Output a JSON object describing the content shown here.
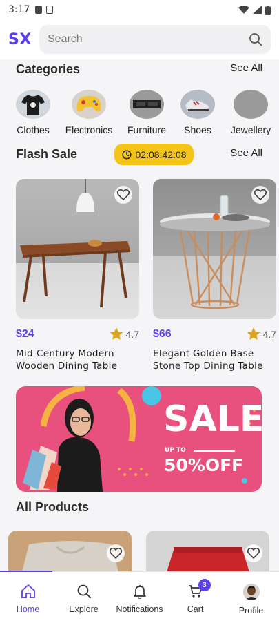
{
  "status_bar": {
    "time": "3:17"
  },
  "header": {
    "logo": "SX",
    "search_placeholder": "Search"
  },
  "categories": {
    "title": "Categories",
    "see_all": "See All",
    "items": [
      {
        "label": "Clothes",
        "icon": "tshirt-image"
      },
      {
        "label": "Electronics",
        "icon": "gamepad-image"
      },
      {
        "label": "Furniture",
        "icon": "tv-console-image"
      },
      {
        "label": "Shoes",
        "icon": "sneakers-image"
      },
      {
        "label": "Jewellery",
        "icon": "placeholder-image"
      }
    ]
  },
  "flash_sale": {
    "title": "Flash Sale",
    "timer": "02:08:42:08",
    "see_all": "See All",
    "products": [
      {
        "price": "$24",
        "rating": "4.7",
        "name_line1": "Mid-Century Modern",
        "name_line2": "Wooden Dining Table"
      },
      {
        "price": "$66",
        "rating": "4.7",
        "name_line1": "Elegant Golden-Base",
        "name_line2": "Stone Top Dining Table"
      }
    ]
  },
  "banner": {
    "headline": "SALE",
    "up_to": "UP TO",
    "discount": "50%OFF"
  },
  "all_products": {
    "title": "All Products"
  },
  "bottom_nav": {
    "items": [
      {
        "label": "Home",
        "icon": "home-icon"
      },
      {
        "label": "Explore",
        "icon": "search-icon"
      },
      {
        "label": "Notifications",
        "icon": "bell-icon"
      },
      {
        "label": "Cart",
        "icon": "cart-icon",
        "badge": "3"
      },
      {
        "label": "Profile",
        "icon": "avatar"
      }
    ]
  },
  "colors": {
    "accent": "#5b3ff0",
    "timer": "#f5c418",
    "banner": "#e8507d",
    "star": "#d9a521"
  }
}
